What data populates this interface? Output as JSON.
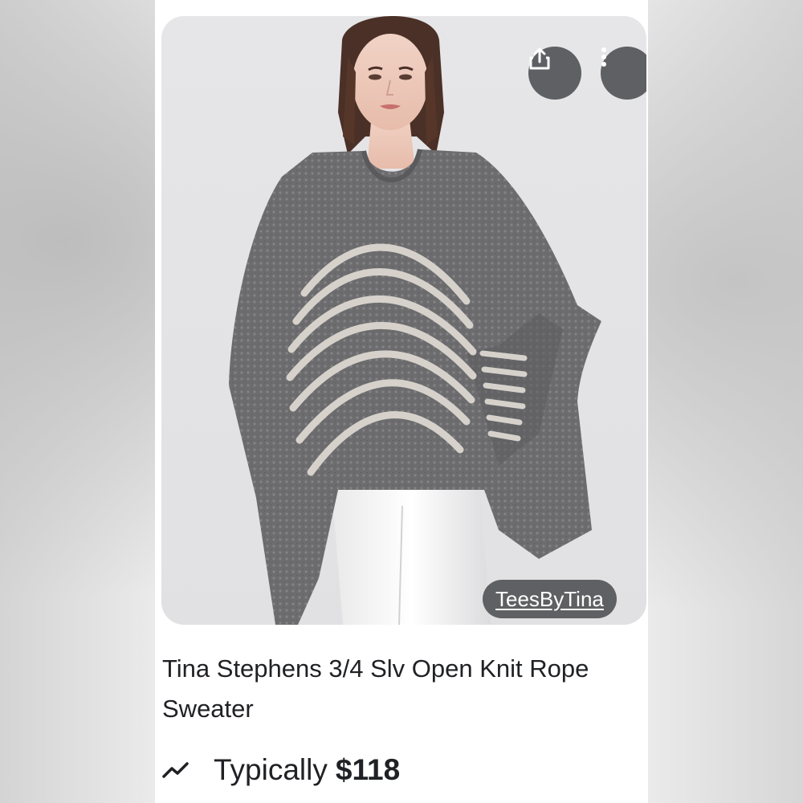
{
  "product": {
    "image_alt": "Woman wearing a gray open-knit poncho sweater with white rope stripes",
    "title": "Tina Stephens 3/4 Slv Open Knit Rope Sweater",
    "seller": "TeesByTina",
    "price_label": "Typically",
    "price_value": "$118"
  },
  "actions": {
    "share_icon": "share-icon",
    "more_icon": "more-vert-icon"
  },
  "icons": {
    "price_trend": "trend-icon"
  },
  "colors": {
    "overlay_button": "#5f6063",
    "text_primary": "#202124",
    "sweater": "#6b6b6d",
    "stripe": "#d6d2cb"
  }
}
